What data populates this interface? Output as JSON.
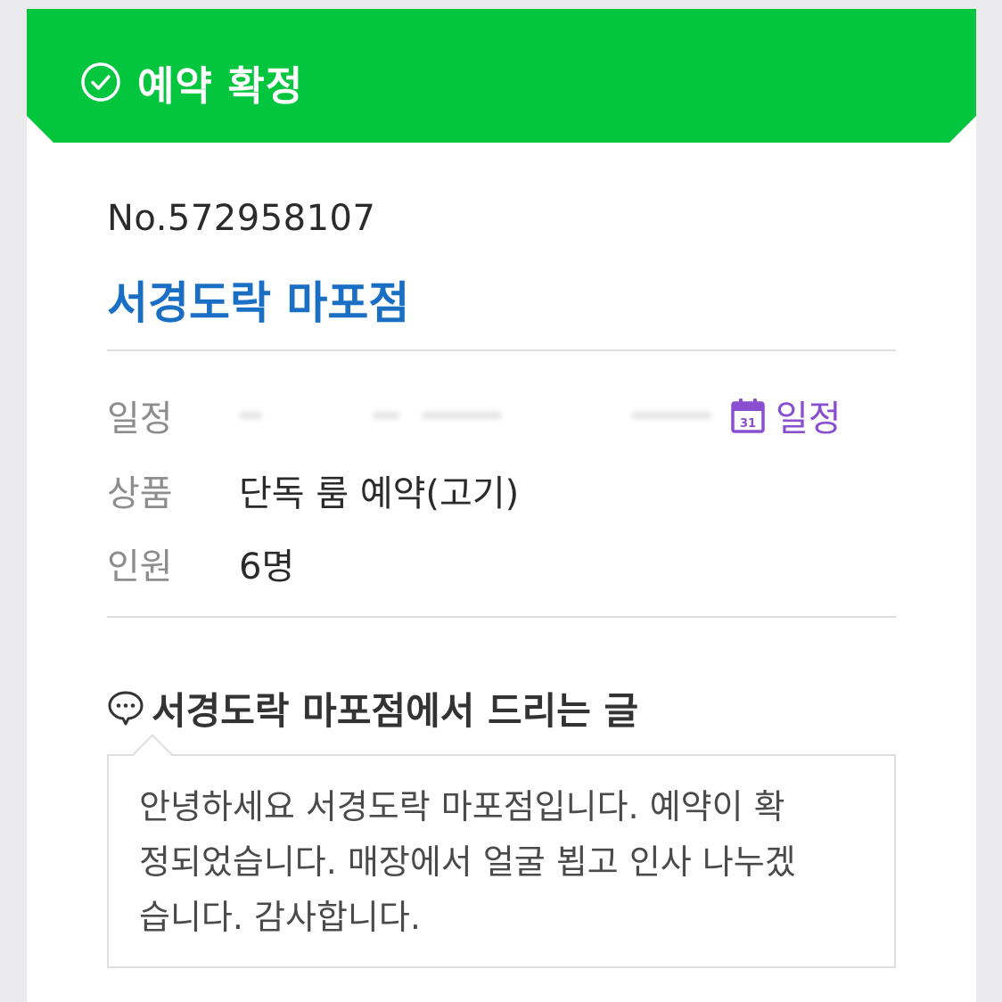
{
  "banner": {
    "icon": "check-circle-icon",
    "title": "예약 확정",
    "color": "#04c53e"
  },
  "booking": {
    "number": "No.572958107",
    "shop_name": "서경도락 마포점"
  },
  "details": {
    "date_label": "일정",
    "calendar_link_label": "일정",
    "calendar_icon": "calendar-icon",
    "product_label": "상품",
    "product_value": "단독 룸 예약(고기)",
    "people_label": "인원",
    "people_value": "6명"
  },
  "message": {
    "icon": "speech-bubble-icon",
    "heading": "서경도락 마포점에서 드리는 글",
    "body": "안녕하세요 서경도락 마포점입니다. 예약이 확\n정되었습니다. 매장에서 얼굴 뵙고 인사 나누겠\n습니다. 감사합니다."
  },
  "colors": {
    "accent_blue": "#1a6fc4",
    "calendar_purple": "#8a4fd0"
  }
}
